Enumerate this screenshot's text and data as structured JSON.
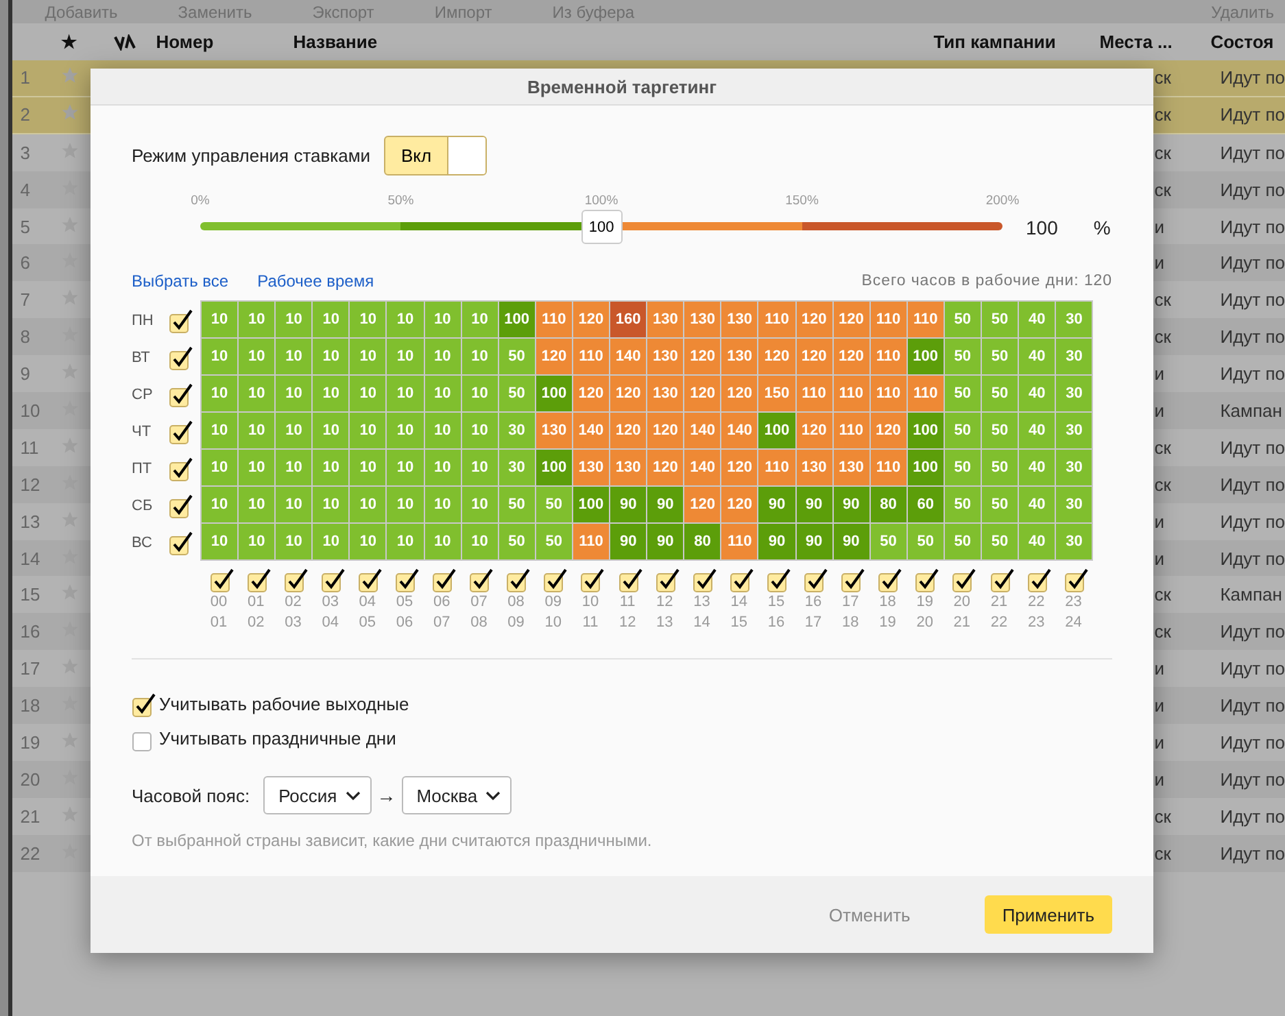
{
  "toolbar": {
    "buttons": [
      "Добавить",
      "Заменить",
      "Экспорт",
      "Импорт",
      "Из буфера",
      "Удалить"
    ]
  },
  "table": {
    "columns": [
      "★",
      "Номер",
      "Название",
      "Тип кампании",
      "Места ...",
      "Состоя"
    ],
    "rows": [
      {
        "number": "1",
        "selected": true,
        "column_5": "ск",
        "status": "Идут по"
      },
      {
        "number": "2",
        "selected": true,
        "column_5": "ск",
        "status": "Идут по"
      },
      {
        "number": "3",
        "selected": false,
        "column_5": "ск",
        "status": "Идут по"
      },
      {
        "number": "4",
        "selected": false,
        "column_5": "ск",
        "status": "Идут по"
      },
      {
        "number": "5",
        "selected": false,
        "column_5": "и",
        "status": "Идут по"
      },
      {
        "number": "6",
        "selected": false,
        "column_5": "и",
        "status": "Идут по"
      },
      {
        "number": "7",
        "selected": false,
        "column_5": "ск",
        "status": "Идут по"
      },
      {
        "number": "8",
        "selected": false,
        "column_5": "ск",
        "status": "Идут по"
      },
      {
        "number": "9",
        "selected": false,
        "column_5": "и",
        "status": "Идут по"
      },
      {
        "number": "10",
        "selected": false,
        "column_5": "и",
        "status": "Кампан"
      },
      {
        "number": "11",
        "selected": false,
        "column_5": "ск",
        "status": "Идут по"
      },
      {
        "number": "12",
        "selected": false,
        "column_5": "ск",
        "status": "Идут по"
      },
      {
        "number": "13",
        "selected": false,
        "column_5": "и",
        "status": "Идут по"
      },
      {
        "number": "14",
        "selected": false,
        "column_5": "и",
        "status": "Идут по"
      },
      {
        "number": "15",
        "selected": false,
        "column_5": "ск",
        "status": "Кампан"
      },
      {
        "number": "16",
        "selected": false,
        "column_5": "ск",
        "status": "Идут по"
      },
      {
        "number": "17",
        "selected": false,
        "column_5": "и",
        "status": "Идут по"
      },
      {
        "number": "18",
        "selected": false,
        "column_5": "и",
        "status": "Идут по"
      },
      {
        "number": "19",
        "selected": false,
        "column_5": "и",
        "status": "Идут по"
      },
      {
        "number": "20",
        "selected": false,
        "column_5": "и",
        "status": "Идут по"
      },
      {
        "number": "21",
        "selected": false,
        "column_5": "ск",
        "status": "Идут по"
      },
      {
        "number": "22",
        "selected": false,
        "column_5": "ск",
        "status": "Идут по"
      }
    ]
  },
  "dialog": {
    "title": "Временной таргетинг",
    "bid_mode": {
      "label": "Режим управления ставками",
      "toggle_label": "Вкл",
      "on": true
    },
    "slider": {
      "ticks": [
        "0%",
        "50%",
        "100%",
        "150%",
        "200%"
      ],
      "level": 0.5,
      "thumb_label": "100",
      "reading": "100",
      "unit": "%"
    },
    "links": [
      "Выбрать все",
      "Рабочее время"
    ],
    "total_hours": "Всего часов в рабочие дни: 120",
    "days": [
      {
        "label": "ПН",
        "checked": true,
        "values": [
          "10",
          "10",
          "10",
          "10",
          "10",
          "10",
          "10",
          "10",
          "100",
          "110",
          "120",
          "160",
          "130",
          "130",
          "130",
          "110",
          "120",
          "120",
          "110",
          "110",
          "50",
          "50",
          "40",
          "30"
        ]
      },
      {
        "label": "ВТ",
        "checked": true,
        "values": [
          "10",
          "10",
          "10",
          "10",
          "10",
          "10",
          "10",
          "10",
          "50",
          "120",
          "110",
          "140",
          "130",
          "120",
          "130",
          "120",
          "120",
          "120",
          "110",
          "100",
          "50",
          "50",
          "40",
          "30"
        ]
      },
      {
        "label": "СР",
        "checked": true,
        "values": [
          "10",
          "10",
          "10",
          "10",
          "10",
          "10",
          "10",
          "10",
          "50",
          "100",
          "120",
          "120",
          "130",
          "120",
          "120",
          "150",
          "110",
          "110",
          "110",
          "110",
          "50",
          "50",
          "40",
          "30"
        ]
      },
      {
        "label": "ЧТ",
        "checked": true,
        "values": [
          "10",
          "10",
          "10",
          "10",
          "10",
          "10",
          "10",
          "10",
          "30",
          "130",
          "140",
          "120",
          "120",
          "140",
          "140",
          "100",
          "120",
          "110",
          "120",
          "100",
          "50",
          "50",
          "40",
          "30"
        ]
      },
      {
        "label": "ПТ",
        "checked": true,
        "values": [
          "10",
          "10",
          "10",
          "10",
          "10",
          "10",
          "10",
          "10",
          "30",
          "100",
          "130",
          "130",
          "120",
          "140",
          "120",
          "110",
          "130",
          "130",
          "110",
          "100",
          "50",
          "50",
          "40",
          "30"
        ]
      },
      {
        "label": "СБ",
        "checked": true,
        "values": [
          "10",
          "10",
          "10",
          "10",
          "10",
          "10",
          "10",
          "10",
          "50",
          "50",
          "100",
          "90",
          "90",
          "120",
          "120",
          "90",
          "90",
          "90",
          "80",
          "60",
          "50",
          "50",
          "40",
          "30"
        ]
      },
      {
        "label": "ВС",
        "checked": true,
        "values": [
          "10",
          "10",
          "10",
          "10",
          "10",
          "10",
          "10",
          "10",
          "50",
          "50",
          "110",
          "90",
          "90",
          "80",
          "110",
          "90",
          "90",
          "90",
          "50",
          "50",
          "50",
          "50",
          "40",
          "30"
        ]
      }
    ],
    "hours": [
      {
        "from": "00",
        "to": "01",
        "checked": true
      },
      {
        "from": "01",
        "to": "02",
        "checked": true
      },
      {
        "from": "02",
        "to": "03",
        "checked": true
      },
      {
        "from": "03",
        "to": "04",
        "checked": true
      },
      {
        "from": "04",
        "to": "05",
        "checked": true
      },
      {
        "from": "05",
        "to": "06",
        "checked": true
      },
      {
        "from": "06",
        "to": "07",
        "checked": true
      },
      {
        "from": "07",
        "to": "08",
        "checked": true
      },
      {
        "from": "08",
        "to": "09",
        "checked": true
      },
      {
        "from": "09",
        "to": "10",
        "checked": true
      },
      {
        "from": "10",
        "to": "11",
        "checked": true
      },
      {
        "from": "11",
        "to": "12",
        "checked": true
      },
      {
        "from": "12",
        "to": "13",
        "checked": true
      },
      {
        "from": "13",
        "to": "14",
        "checked": true
      },
      {
        "from": "14",
        "to": "15",
        "checked": true
      },
      {
        "from": "15",
        "to": "16",
        "checked": true
      },
      {
        "from": "16",
        "to": "17",
        "checked": true
      },
      {
        "from": "17",
        "to": "18",
        "checked": true
      },
      {
        "from": "18",
        "to": "19",
        "checked": true
      },
      {
        "from": "19",
        "to": "20",
        "checked": true
      },
      {
        "from": "20",
        "to": "21",
        "checked": true
      },
      {
        "from": "21",
        "to": "22",
        "checked": true
      },
      {
        "from": "22",
        "to": "23",
        "checked": true
      },
      {
        "from": "23",
        "to": "24",
        "checked": true
      }
    ],
    "options": [
      {
        "label": "Учитывать рабочие выходные",
        "checked": true
      },
      {
        "label": "Учитывать праздничные дни",
        "checked": false
      }
    ],
    "timezone": {
      "label": "Часовой пояс:",
      "country": "Россия",
      "arrow": "→",
      "city": "Москва"
    },
    "hint": "От выбранной страны зависит, какие дни считаются праздничными.",
    "buttons": [
      {
        "label": "Отменить",
        "kind": "secondary"
      },
      {
        "label": "Применить",
        "kind": "primary"
      }
    ]
  }
}
